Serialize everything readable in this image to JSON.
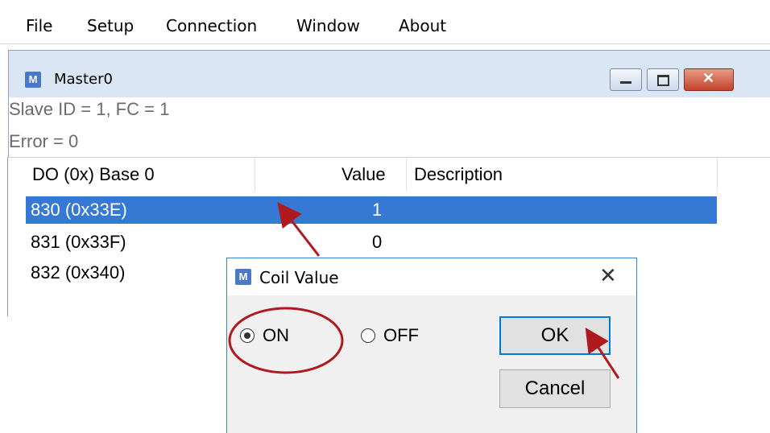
{
  "menubar": {
    "items": [
      "File",
      "Setup",
      "Connection",
      "Window",
      "About"
    ]
  },
  "child_window": {
    "icon_letter": "M",
    "title": "Master0",
    "info_line1": "Slave ID = 1, FC = 1",
    "info_line2": "Error = 0",
    "columns": [
      "DO (0x) Base 0",
      "Value",
      "Description"
    ],
    "rows": [
      {
        "address": "830 (0x33E)",
        "value": "1",
        "description": ""
      },
      {
        "address": "831 (0x33F)",
        "value": "0",
        "description": ""
      },
      {
        "address": "832 (0x340)",
        "value": "",
        "description": ""
      }
    ]
  },
  "dialog": {
    "icon_letter": "M",
    "title": "Coil Value",
    "close_glyph": "✕",
    "radio_on_label": "ON",
    "radio_off_label": "OFF",
    "ok_label": "OK",
    "cancel_label": "Cancel",
    "selected_option": "ON"
  },
  "colors": {
    "selection": "#3579d4",
    "annotation": "#b0191e"
  }
}
